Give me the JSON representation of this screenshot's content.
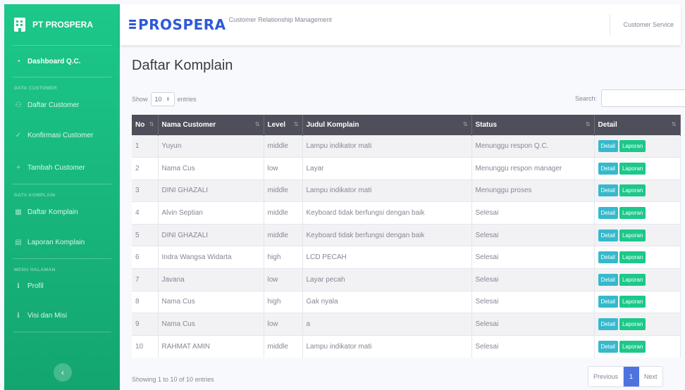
{
  "sidebar": {
    "brand": "PT PROSPERA",
    "dashboard": "Dashboard Q.C.",
    "heading_customer": "DATA CUSTOMER",
    "daftar_customer": "Daftar Customer",
    "konfirmasi_customer": "Konfirmasi Customer",
    "tambah_customer": "Tambah Customer",
    "heading_komplain": "DATA KOMPLAIN",
    "daftar_komplain": "Daftar Komplain",
    "laporan_komplain": "Laporan Komplain",
    "heading_menu": "MENU HALAMAN",
    "profil": "Profil",
    "visi_misi": "Visi dan Misi",
    "toggle_glyph": "‹"
  },
  "topbar": {
    "logo": "PROSPERA",
    "subtitle": "Customer Relationship Management",
    "user": "Customer Service"
  },
  "page": {
    "title": "Daftar Komplain",
    "show_label": "Show",
    "entries_label": "entries",
    "entries_value": "10",
    "search_label": "Search:"
  },
  "table": {
    "headers": [
      "No",
      "Nama Customer",
      "Level",
      "Judul Komplain",
      "Status",
      "Detail"
    ],
    "detail_btn": "Detail",
    "laporan_btn": "Laporan",
    "rows": [
      [
        "1",
        "Yuyun",
        "middle",
        "Lampu indikator mati",
        "Menunggu respon Q.C."
      ],
      [
        "2",
        "Nama Cus",
        "low",
        "Layar",
        "Menunggu respon manager"
      ],
      [
        "3",
        "DINI GHAZALI",
        "middle",
        "Lampu indikator mati",
        "Menunggu proses"
      ],
      [
        "4",
        "Alvin Septian",
        "middle",
        "Keyboard tidak berfungsi dengan baik",
        "Selesai"
      ],
      [
        "5",
        "DINI GHAZALI",
        "middle",
        "Keyboard tidak berfungsi dengan baik",
        "Selesai"
      ],
      [
        "6",
        "Indra Wangsa Widarta",
        "high",
        "LCD PECAH",
        "Selesai"
      ],
      [
        "7",
        "Javana",
        "low",
        "Layar pecah",
        "Selesai"
      ],
      [
        "8",
        "Nama Cus",
        "high",
        "Gak nyala",
        "Selesai"
      ],
      [
        "9",
        "Nama Cus",
        "low",
        "a",
        "Selesai"
      ],
      [
        "10",
        "RAHMAT AMIN",
        "middle",
        "Lampu indikator mati",
        "Selesai"
      ]
    ]
  },
  "footer": {
    "info": "Showing 1 to 10 of 10 entries",
    "previous": "Previous",
    "current_page": "1",
    "next": "Next"
  },
  "colors": {
    "sidebar": "#1cc88a",
    "accent": "#4e73df",
    "header": "#4e4f5a",
    "detail_btn": "#36b9cc",
    "laporan_btn": "#1cc88a"
  }
}
